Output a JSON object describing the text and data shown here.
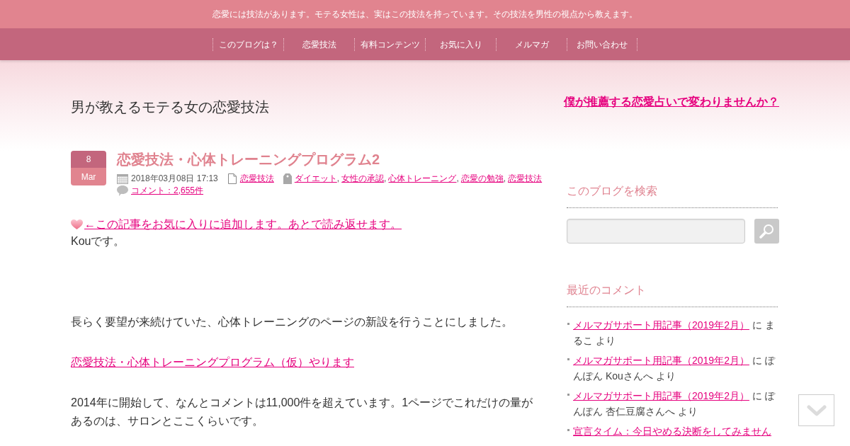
{
  "tagline": "恋愛には技法があります。モテる女性は、実はこの技法を持っています。その技法を男性の視点から教えます。",
  "nav": [
    {
      "label": "このブログは？"
    },
    {
      "label": "恋愛技法"
    },
    {
      "label": "有料コンテンツ"
    },
    {
      "label": "お気に入り"
    },
    {
      "label": "メルマガ"
    },
    {
      "label": "お問い合わせ"
    }
  ],
  "site_title": "男が教えるモテる女の恋愛技法",
  "promo_link": "僕が推薦する恋愛占いで変わりませんか？",
  "post": {
    "date": {
      "day": "8",
      "month": "Mar"
    },
    "title": "恋愛技法・心体トレーニングプログラム2",
    "datetime": "2018年03月08日 17:13",
    "category": "恋愛技法",
    "tags": [
      "ダイエット",
      "女性の承認",
      "心体トレーニング",
      "恋愛の勉強",
      "恋愛技法"
    ],
    "tag_separator": ",",
    "comments_link": "コメント：2,655件",
    "favorite_link": "←この記事をお気に入りに追加します。あとで読み返せます。",
    "greeting": "Kouです。",
    "paragraphs": [
      {
        "kind": "text",
        "text": "長らく要望が来続けていた、心体トレーニングのページの新設を行うことにしました。"
      },
      {
        "kind": "link",
        "text": "恋愛技法・心体トレーニングプログラム（仮）やります"
      },
      {
        "kind": "text",
        "text": "2014年に開始して、なんとコメントは11,000件を超えています。1ページでこれだけの量があるのは、サロンとここくらいです。"
      }
    ]
  },
  "sidebar": {
    "search": {
      "title": "このブログを検索"
    },
    "recent_comments": {
      "title": "最近のコメント",
      "items": [
        {
          "link": "メルマガサポート用記事（2019年2月）",
          "text": "に まるこ より"
        },
        {
          "link": "メルマガサポート用記事（2019年2月）",
          "text": "に ぽんぽん Kouさんへ より"
        },
        {
          "link": "メルマガサポート用記事（2019年2月）",
          "text": "に ぽんぽん 杏仁豆腐さんへ より"
        },
        {
          "link": "宣言タイム：今日やめる決断をしてみません"
        }
      ]
    }
  }
}
